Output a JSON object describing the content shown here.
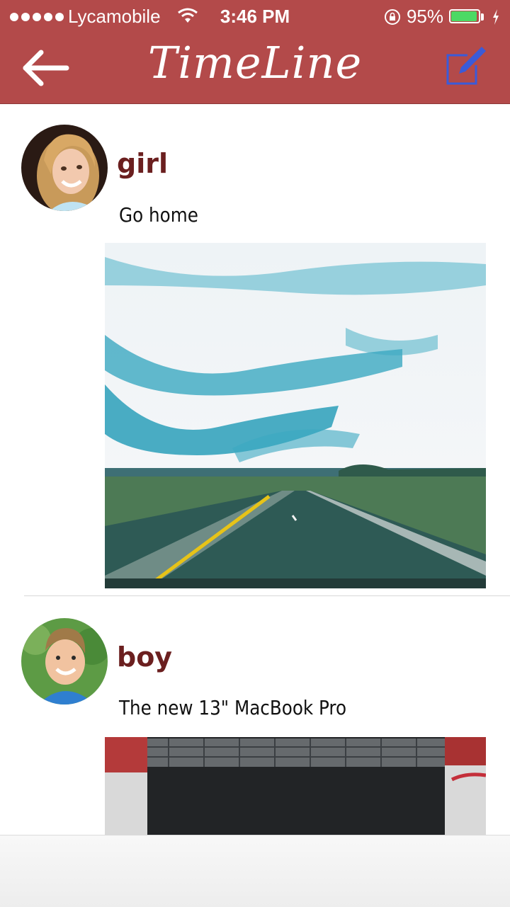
{
  "status_bar": {
    "carrier": "Lycamobile",
    "time": "3:46 PM",
    "battery": "95%",
    "battery_level": 0.95,
    "battery_color": "#4cd964"
  },
  "nav": {
    "title": "TimeLine",
    "back_icon": "arrow-left-icon",
    "compose_icon": "compose-icon",
    "bar_color": "#b34a4a",
    "compose_icon_color": "#3a5bd9"
  },
  "posts": [
    {
      "username": "girl",
      "text": "Go home",
      "avatar": "girl-avatar",
      "image": "highway-sky-photo"
    },
    {
      "username": "boy",
      "text": "The new 13\" MacBook Pro",
      "avatar": "boy-avatar",
      "image": "macbook-photo"
    }
  ],
  "theme": {
    "username_color": "#6b1f1f"
  }
}
